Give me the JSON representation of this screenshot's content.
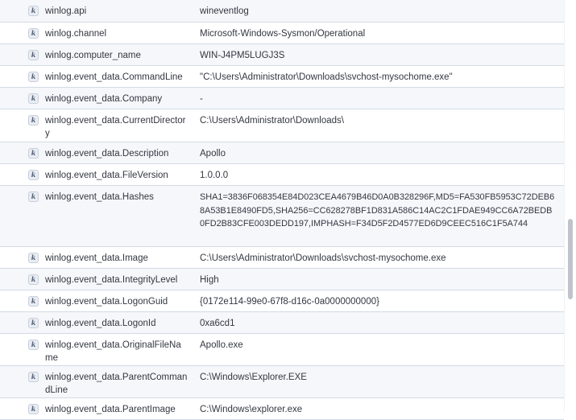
{
  "field_type_icon": "k",
  "rows": [
    {
      "field": "winlog.api",
      "value": "wineventlog"
    },
    {
      "field": "winlog.channel",
      "value": "Microsoft-Windows-Sysmon/Operational"
    },
    {
      "field": "winlog.computer_name",
      "value": "WIN-J4PM5LUGJ3S"
    },
    {
      "field": "winlog.event_data.CommandLine",
      "value": "\"C:\\Users\\Administrator\\Downloads\\svchost-mysochome.exe\""
    },
    {
      "field": "winlog.event_data.Company",
      "value": "-"
    },
    {
      "field": "winlog.event_data.CurrentDirectory",
      "value": "C:\\Users\\Administrator\\Downloads\\"
    },
    {
      "field": "winlog.event_data.Description",
      "value": "Apollo"
    },
    {
      "field": "winlog.event_data.FileVersion",
      "value": "1.0.0.0"
    },
    {
      "field": "winlog.event_data.Hashes",
      "value": "SHA1=3836F068354E84D023CEA4679B46D0A0B328296F,MD5=FA530FB5953C72DEB68A53B1E8490FD5,SHA256=CC628278BF1D831A586C14AC2C1FDAE949CC6A72BEDB0FD2B83CFE003DEDD197,IMPHASH=F34D5F2D4577ED6D9CEEC516C1F5A744"
    },
    {
      "field": "winlog.event_data.Image",
      "value": "C:\\Users\\Administrator\\Downloads\\svchost-mysochome.exe"
    },
    {
      "field": "winlog.event_data.IntegrityLevel",
      "value": "High"
    },
    {
      "field": "winlog.event_data.LogonGuid",
      "value": "{0172e114-99e0-67f8-d16c-0a0000000000}"
    },
    {
      "field": "winlog.event_data.LogonId",
      "value": "0xa6cd1"
    },
    {
      "field": "winlog.event_data.OriginalFileName",
      "value": "Apollo.exe"
    },
    {
      "field": "winlog.event_data.ParentCommandLine",
      "value": "C:\\Windows\\Explorer.EXE"
    },
    {
      "field": "winlog.event_data.ParentImage",
      "value": "C:\\Windows\\explorer.exe"
    }
  ]
}
